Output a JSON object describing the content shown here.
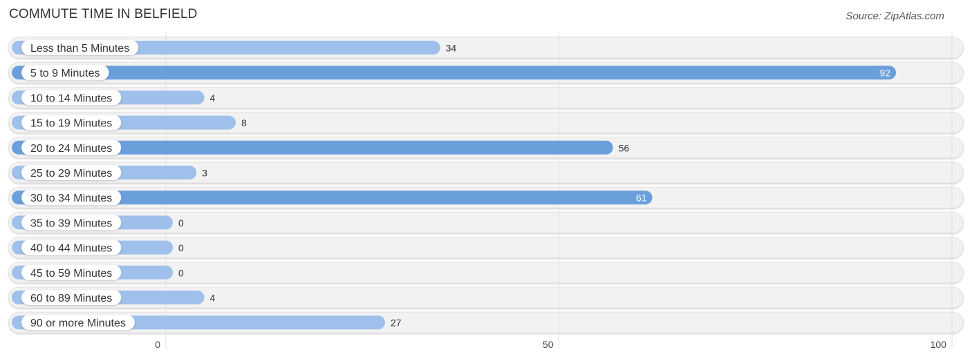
{
  "header": {
    "title": "COMMUTE TIME IN BELFIELD",
    "source": "Source: ZipAtlas.com"
  },
  "colors": {
    "bar_strong": "#6a9fdc",
    "bar_light": "#9ec0ea",
    "track": "#f2f2f2",
    "grid": "#dddddd"
  },
  "chart_data": {
    "type": "bar",
    "orientation": "horizontal",
    "title": "COMMUTE TIME IN BELFIELD",
    "xlabel": "",
    "ylabel": "",
    "categories": [
      "Less than 5 Minutes",
      "5 to 9 Minutes",
      "10 to 14 Minutes",
      "15 to 19 Minutes",
      "20 to 24 Minutes",
      "25 to 29 Minutes",
      "30 to 34 Minutes",
      "35 to 39 Minutes",
      "40 to 44 Minutes",
      "45 to 59 Minutes",
      "60 to 89 Minutes",
      "90 or more Minutes"
    ],
    "values": [
      34,
      92,
      4,
      8,
      56,
      3,
      61,
      0,
      0,
      0,
      4,
      27
    ],
    "xlim": [
      0,
      100
    ],
    "xticks": [
      0,
      50,
      100
    ],
    "xtick_labels": [
      "0",
      "50",
      "100"
    ],
    "grid": true,
    "legend": "none"
  }
}
